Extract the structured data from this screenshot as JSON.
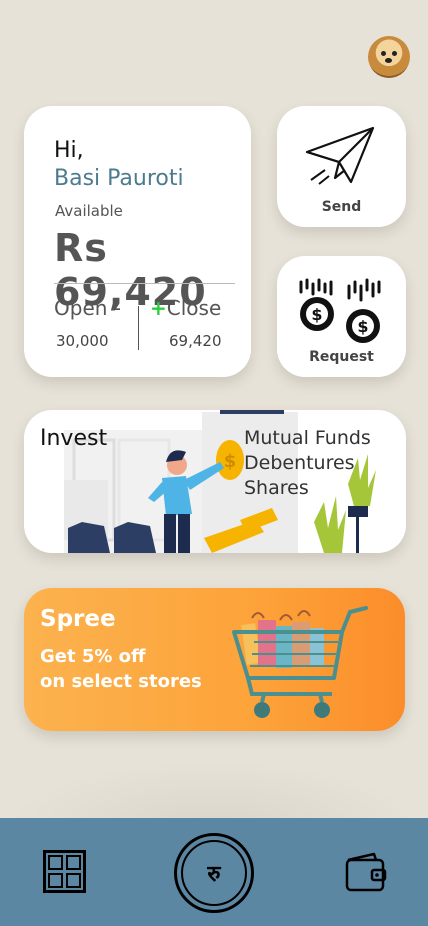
{
  "header": {
    "avatar_icon": "doge-avatar"
  },
  "balance_card": {
    "greeting": "Hi,",
    "name": "Basi Pauroti",
    "available_label": "Available",
    "amount": "Rs 69,420",
    "open_label": "Open -",
    "open_value": "30,000",
    "close_sign": "+",
    "close_label": "Close",
    "close_value": "69,420"
  },
  "actions": {
    "send_label": "Send",
    "send_icon": "paper-plane-icon",
    "request_label": "Request",
    "request_icon": "falling-coins-icon"
  },
  "invest": {
    "title": "Invest",
    "items": [
      "Mutual Funds",
      "Debentures",
      "Shares"
    ]
  },
  "spree": {
    "title": "Spree",
    "line1": "Get 5% off",
    "line2": "on select stores"
  },
  "nav": {
    "home_icon": "grid-icon",
    "pay_icon": "rupee-icon",
    "pay_glyph": "रु",
    "wallet_icon": "wallet-icon",
    "bar_color": "#5c87a3"
  },
  "colors": {
    "accent": "#4c7b8f",
    "positive": "#2ecc40",
    "spree": "#fda33a",
    "background": "#e7e2d7"
  }
}
